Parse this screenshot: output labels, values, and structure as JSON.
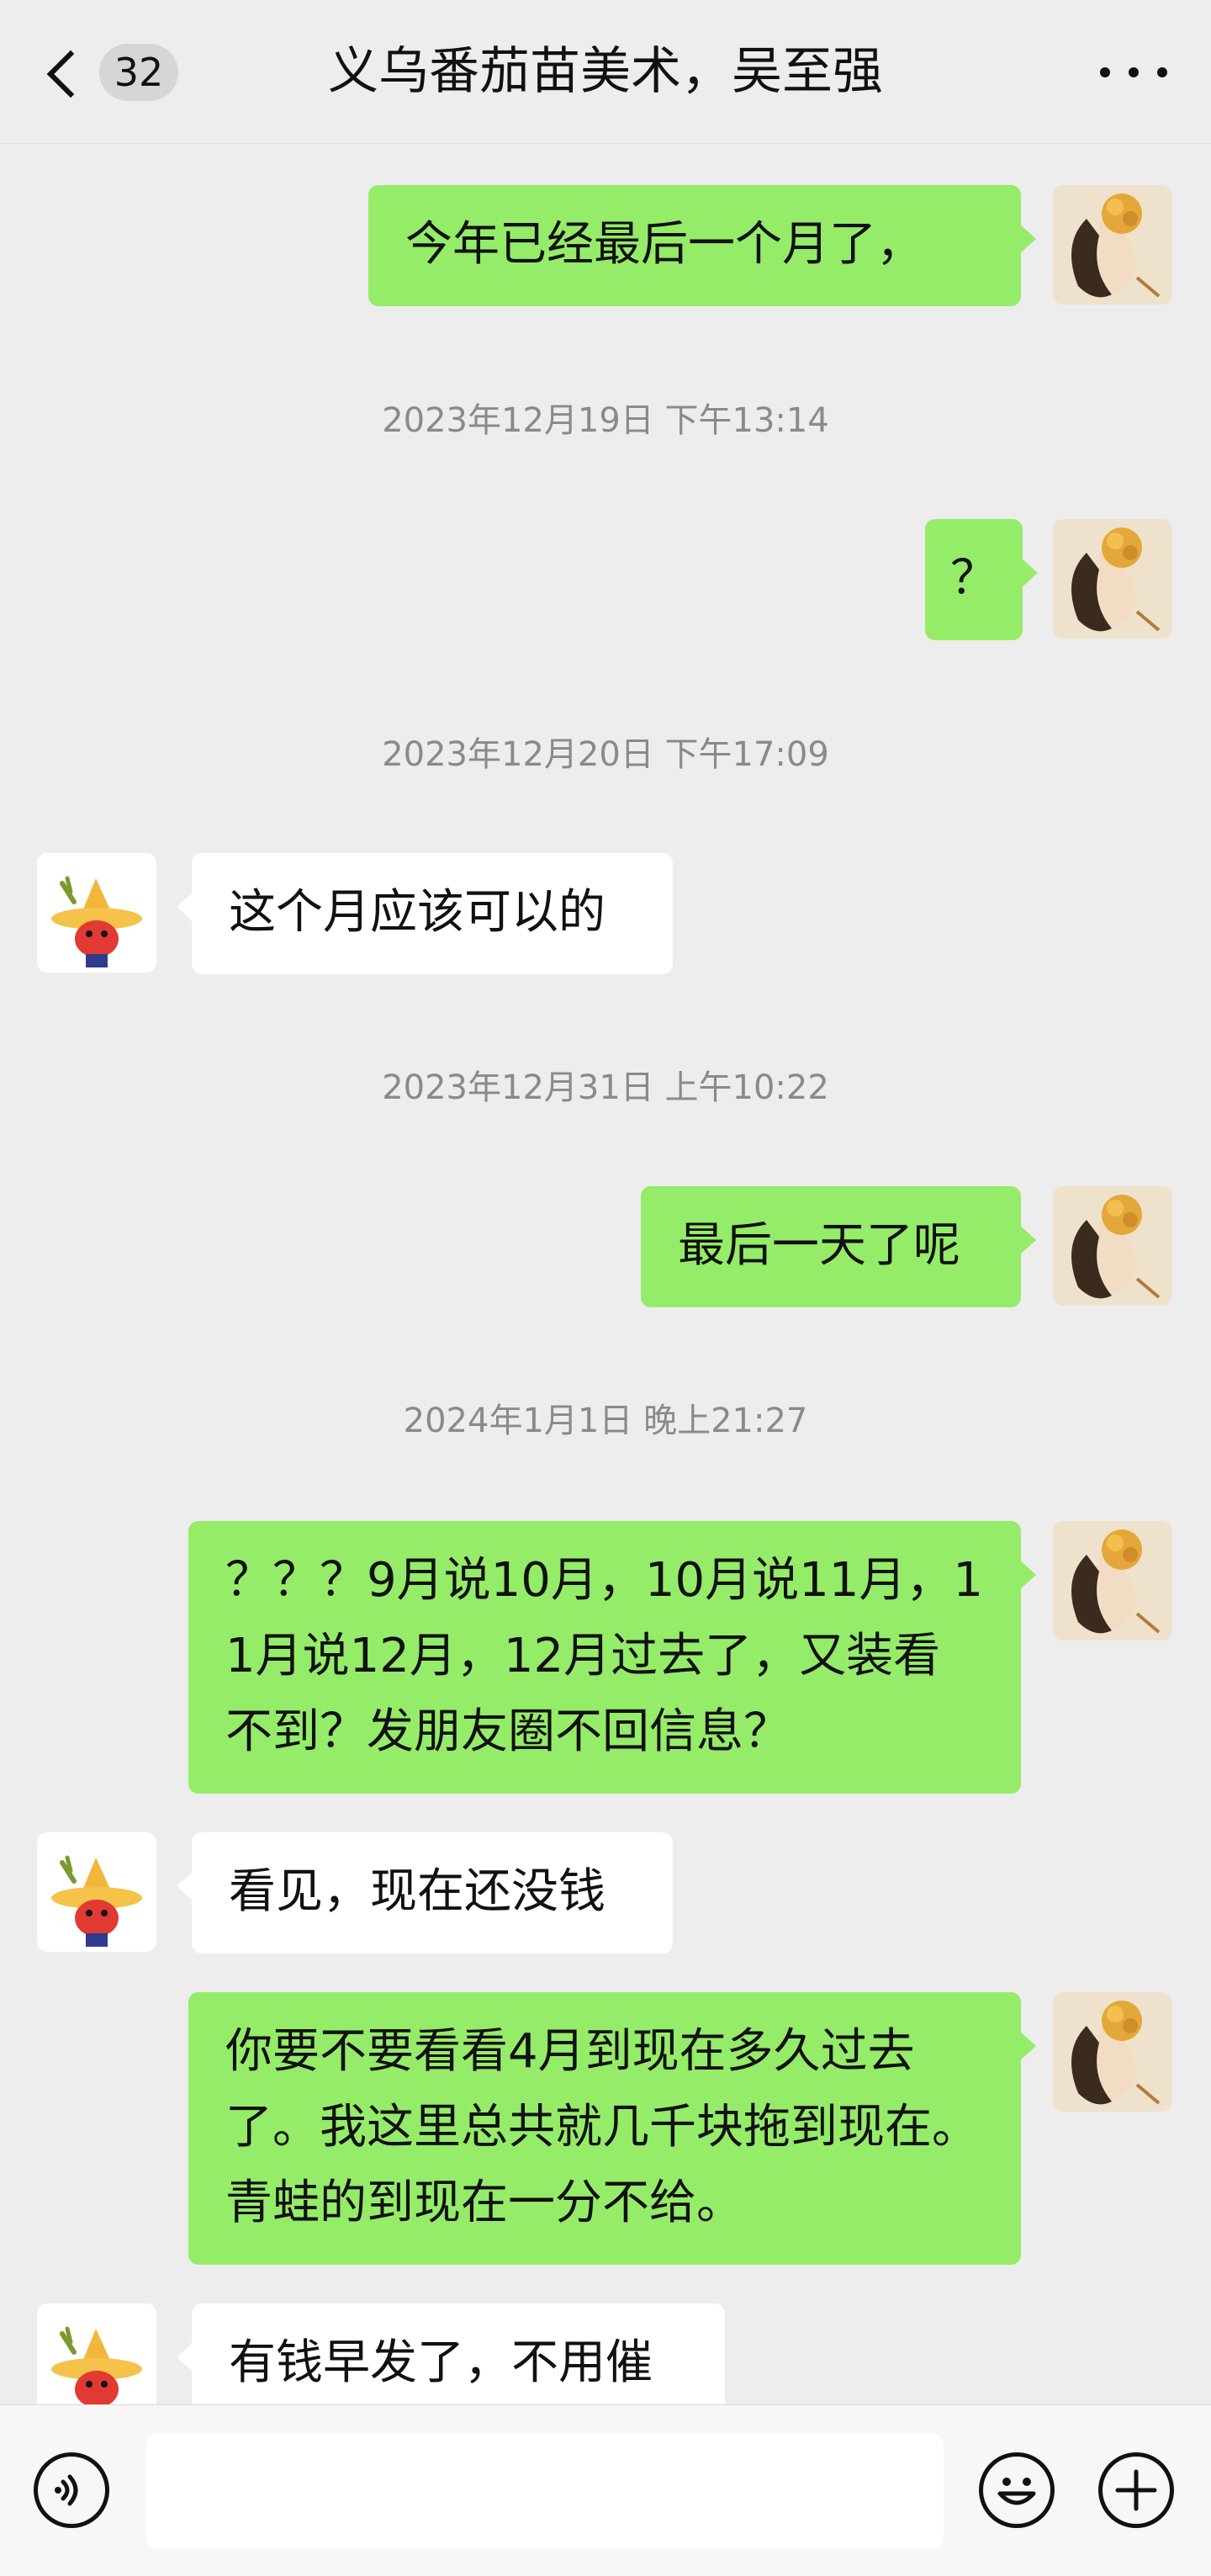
{
  "header": {
    "unread_count": "32",
    "title": "义乌番茄苗美术，吴至强"
  },
  "messages": [
    {
      "type": "bubble",
      "side": "mine",
      "text": "今年已经最后一个月了，"
    },
    {
      "type": "time",
      "text": "2023年12月19日 下午13:14"
    },
    {
      "type": "bubble",
      "side": "mine",
      "text": "？"
    },
    {
      "type": "time",
      "text": "2023年12月20日 下午17:09"
    },
    {
      "type": "bubble",
      "side": "theirs",
      "text": "这个月应该可以的"
    },
    {
      "type": "time",
      "text": "2023年12月31日 上午10:22"
    },
    {
      "type": "bubble",
      "side": "mine",
      "text": "最后一天了呢"
    },
    {
      "type": "time",
      "text": "2024年1月1日 晚上21:27"
    },
    {
      "type": "bubble",
      "side": "mine",
      "text": "？？？9月说10月，10月说11月，11月说12月，12月过去了，又装看不到？发朋友圈不回信息？"
    },
    {
      "type": "bubble",
      "side": "theirs",
      "text": "看见，现在还没钱"
    },
    {
      "type": "bubble",
      "side": "mine",
      "text": "你要不要看看4月到现在多久过去了。我这里总共就几千块拖到现在。青蛙的到现在一分不给。"
    },
    {
      "type": "bubble",
      "side": "theirs",
      "text": "有钱早发了，不用催"
    }
  ],
  "input": {
    "value": "",
    "voice_icon": "voice-icon",
    "emoji_icon": "emoji-icon",
    "plus_icon": "plus-icon"
  },
  "colors": {
    "mine_bubble": "#95ec69",
    "theirs_bubble": "#ffffff",
    "background": "#ededed"
  }
}
